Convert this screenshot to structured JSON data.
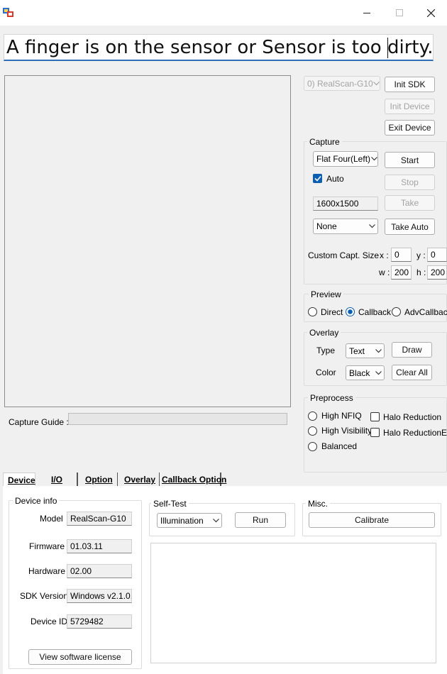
{
  "window": {
    "icons": {
      "app": "app-icon",
      "minimize": "minimize-icon",
      "maximize": "maximize-icon",
      "close": "close-icon"
    }
  },
  "status_message": "A finger is on the sensor or Sensor is too dirty. Cle",
  "device_select": {
    "value": "0) RealScan-G10"
  },
  "buttons": {
    "init_sdk": "Init SDK",
    "init_device": "Init Device",
    "exit_device": "Exit Device"
  },
  "capture": {
    "title": "Capture",
    "mode": "Flat Four(Left)",
    "start": "Start",
    "auto_label": "Auto",
    "auto_checked": true,
    "stop": "Stop",
    "resolution": "1600x1500",
    "take": "Take",
    "option": "None",
    "take_auto": "Take Auto",
    "custom_size_label": "Custom Capt. Size",
    "x_label": "x :",
    "x": "0",
    "y_label": "y :",
    "y": "0",
    "w_label": "w :",
    "w": "200",
    "h_label": "h :",
    "h": "200"
  },
  "preview": {
    "title": "Preview",
    "options": [
      "Direct",
      "Callback",
      "AdvCallback"
    ],
    "selected": "Callback"
  },
  "overlay": {
    "title": "Overlay",
    "type_label": "Type",
    "type": "Text",
    "color_label": "Color",
    "color": "Black",
    "draw": "Draw",
    "clear_all": "Clear All"
  },
  "preprocess": {
    "title": "Preprocess",
    "radios": [
      "High NFIQ",
      "High Visibility",
      "Balanced"
    ],
    "checks": [
      "Halo Reduction",
      "Halo ReductionEx"
    ]
  },
  "capture_guide_label": "Capture Guide :",
  "tabs": [
    "Device",
    "I/O",
    "Option",
    "Overlay",
    "Callback Option"
  ],
  "device_info": {
    "title": "Device info",
    "model_label": "Model",
    "model": "RealScan-G10",
    "firmware_label": "Firmware",
    "firmware": "01.03.11",
    "hardware_label": "Hardware",
    "hardware": "02.00",
    "sdk_label": "SDK Version",
    "sdk": "Windows v2.1.0.",
    "device_id_label": "Device ID",
    "device_id": "5729482",
    "license_button": "View software license"
  },
  "self_test": {
    "title": "Self-Test",
    "mode": "Illumination",
    "run": "Run"
  },
  "misc": {
    "title": "Misc.",
    "calibrate": "Calibrate"
  },
  "colors": {
    "accent": "#0a5fb3",
    "status_underline": "#2f6fb7",
    "window_bg": "#f0f0f0"
  }
}
